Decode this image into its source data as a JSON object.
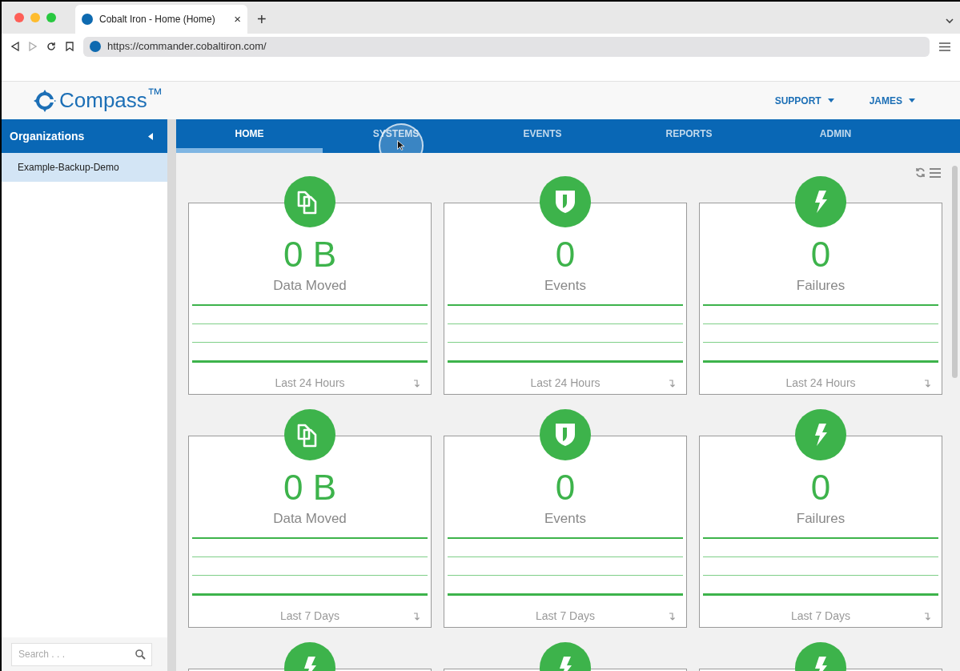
{
  "browser": {
    "tab_title": "Cobalt Iron - Home (Home)",
    "tab_close": "×",
    "new_tab": "+",
    "url": "https://commander.cobaltiron.com/"
  },
  "header": {
    "logo": "Compass$^{™}$",
    "menus": [
      {
        "label": "SUPPORT"
      },
      {
        "label": "JAMES"
      }
    ]
  },
  "sidebar": {
    "title": "Organizations",
    "items": [
      {
        "label": "Example-Backup-Demo",
        "selected": true
      }
    ],
    "search": {
      "placeholder": "Search . . ."
    }
  },
  "nav_tabs": [
    {
      "label": "HOME",
      "selected": true
    },
    {
      "label": "SYSTEMS",
      "selected": false
    },
    {
      "label": "EVENTS",
      "selected": false
    },
    {
      "label": "REPORTS",
      "selected": false
    },
    {
      "label": "ADMIN",
      "selected": false
    }
  ],
  "card_rows": [
    {
      "cards": [
        {
          "kind": "data",
          "value": "0 B",
          "label": "Data Moved",
          "period": "Last 24 Hours"
        },
        {
          "kind": "events",
          "value": "0",
          "label": "Events",
          "period": "Last 24 Hours"
        },
        {
          "kind": "failures",
          "value": "0",
          "label": "Failures",
          "period": "Last 24 Hours"
        }
      ]
    },
    {
      "cards": [
        {
          "kind": "data",
          "value": "0 B",
          "label": "Data Moved",
          "period": "Last 7 Days"
        },
        {
          "kind": "events",
          "value": "0",
          "label": "Events",
          "period": "Last 7 Days"
        },
        {
          "kind": "failures",
          "value": "0",
          "label": "Failures",
          "period": "Last 7 Days"
        }
      ]
    },
    {
      "cards": [
        {
          "kind": "failures"
        },
        {
          "kind": "failures"
        },
        {
          "kind": "failures"
        }
      ]
    }
  ]
}
